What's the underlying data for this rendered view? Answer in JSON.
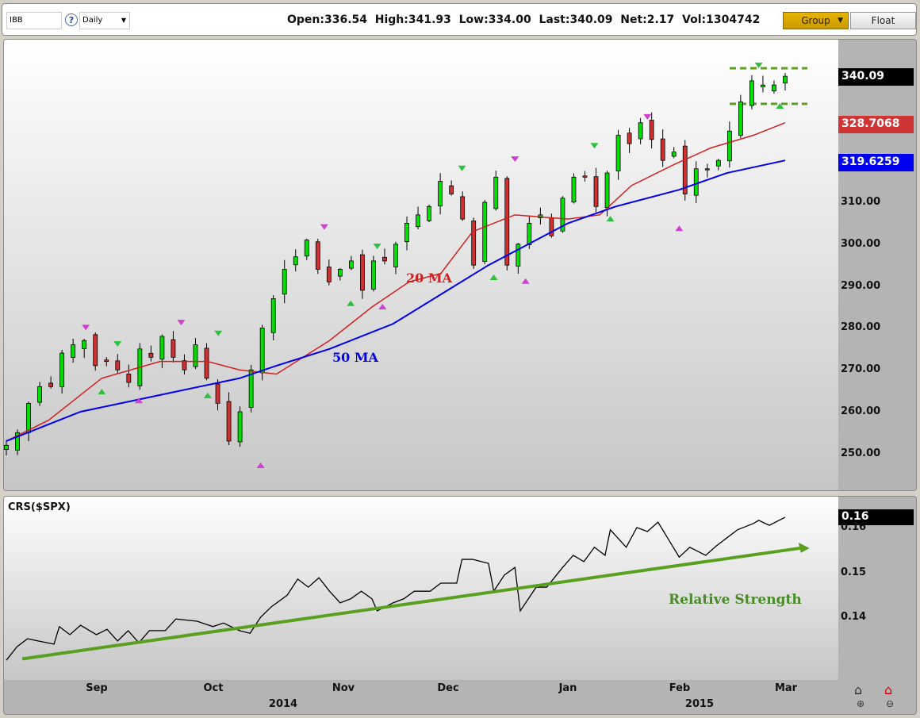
{
  "toolbar": {
    "symbol": "IBB",
    "help": "?",
    "period": "Daily",
    "quote": "Open:336.54  High:341.93  Low:334.00  Last:340.09  Net:2.17  Vol:1304742",
    "group_label": "Group",
    "float_label": "Float"
  },
  "colors": {
    "up": "#00e000",
    "down": "#d03030",
    "ma20": "#d02020",
    "ma50": "#0000ee",
    "rs": "#5aa020",
    "last": "#000000"
  },
  "chart_data": [
    {
      "type": "candlestick",
      "title": "IBB Daily",
      "ylim": [
        244,
        348
      ],
      "price_ticks": [
        "250.00",
        "260.00",
        "270.00",
        "280.00",
        "290.00",
        "300.00",
        "310.00"
      ],
      "last_label": "340.09",
      "ma20_label": "328.7068",
      "ma50_label": "319.6259",
      "closes": [
        252,
        255,
        262,
        266,
        266,
        274,
        276,
        277,
        271,
        272,
        270,
        267,
        275,
        273,
        278,
        273,
        270,
        276,
        268,
        262,
        253,
        260,
        270,
        280,
        287,
        294,
        297,
        301,
        294,
        291,
        294,
        296,
        289,
        296,
        296,
        300,
        305,
        307,
        309,
        315,
        312,
        306,
        295,
        310,
        316,
        295,
        300,
        305,
        307,
        302,
        311,
        316,
        316,
        309,
        317,
        326,
        324,
        329,
        325,
        320,
        322,
        312,
        318,
        318,
        320,
        327,
        334,
        339,
        338,
        338,
        340.09
      ],
      "days_total": 147,
      "ma20": {
        "label": "20 MA",
        "points": [
          [
            0,
            253
          ],
          [
            8,
            258
          ],
          [
            18,
            268
          ],
          [
            29,
            272
          ],
          [
            38,
            272
          ],
          [
            44,
            270
          ],
          [
            51,
            269
          ],
          [
            61,
            277
          ],
          [
            69,
            285
          ],
          [
            76,
            291
          ],
          [
            82,
            293
          ],
          [
            88,
            303
          ],
          [
            96,
            307
          ],
          [
            106,
            306
          ],
          [
            112,
            307
          ],
          [
            118,
            314
          ],
          [
            126,
            319
          ],
          [
            133,
            323
          ],
          [
            141,
            326
          ],
          [
            147,
            329
          ]
        ]
      },
      "ma50": {
        "label": "50 MA",
        "points": [
          [
            0,
            253
          ],
          [
            14,
            260
          ],
          [
            29,
            264
          ],
          [
            44,
            268
          ],
          [
            51,
            271
          ],
          [
            61,
            275
          ],
          [
            73,
            281
          ],
          [
            82,
            288
          ],
          [
            91,
            295
          ],
          [
            97,
            299
          ],
          [
            106,
            305
          ],
          [
            115,
            309
          ],
          [
            127,
            313
          ],
          [
            136,
            317
          ],
          [
            147,
            320
          ]
        ]
      },
      "markers": [
        [
          15,
          280,
          "top"
        ],
        [
          33,
          281.2,
          "top"
        ],
        [
          60,
          304,
          "top"
        ],
        [
          96,
          320.2,
          "top"
        ],
        [
          121,
          330.3,
          "top"
        ],
        [
          25,
          262.8,
          "bottom"
        ],
        [
          48,
          247.3,
          "bottom"
        ],
        [
          71,
          285.2,
          "bottom"
        ],
        [
          98,
          291.3,
          "bottom"
        ],
        [
          127,
          303.9,
          "bottom"
        ],
        [
          21,
          276.1,
          "gdown"
        ],
        [
          40,
          278.6,
          "gdown"
        ],
        [
          70,
          299.4,
          "gdown"
        ],
        [
          86,
          318,
          "gdown"
        ],
        [
          111,
          323.4,
          "gdown"
        ],
        [
          142,
          342.6,
          "gdown"
        ],
        [
          18,
          264.9,
          "gup"
        ],
        [
          38,
          264,
          "gup"
        ],
        [
          65,
          286,
          "gup"
        ],
        [
          92,
          292.2,
          "gup"
        ],
        [
          114,
          306.2,
          "gup"
        ],
        [
          146,
          333.1,
          "gup"
        ]
      ],
      "range_box": [
        333.5,
        342
      ]
    },
    {
      "type": "line",
      "title": "CRS($SPX)",
      "ylim": [
        0.12,
        0.166
      ],
      "ticks": [
        "0.14",
        "0.15",
        "0.16"
      ],
      "last_label": "0.16",
      "annotation": "Relative Strength",
      "x": [
        0,
        2,
        4,
        6,
        9,
        10,
        12,
        14,
        17,
        19,
        21,
        23,
        25,
        27,
        30,
        32,
        36,
        39,
        41,
        44,
        46,
        48,
        50,
        53,
        55,
        57,
        59,
        61,
        63,
        65,
        67,
        69,
        70,
        73,
        75,
        77,
        80,
        82,
        85,
        86,
        88,
        91,
        92,
        94,
        96,
        97,
        100,
        102,
        105,
        107,
        109,
        111,
        113,
        114,
        117,
        119,
        121,
        123,
        125,
        127,
        129,
        132,
        134,
        136,
        138,
        141,
        142,
        144,
        147
      ],
      "y": [
        0.1305,
        0.1335,
        0.1353,
        0.1348,
        0.1341,
        0.138,
        0.1362,
        0.1383,
        0.1362,
        0.1374,
        0.1348,
        0.1371,
        0.1344,
        0.1371,
        0.1371,
        0.1397,
        0.1392,
        0.138,
        0.1388,
        0.1371,
        0.1365,
        0.1401,
        0.1424,
        0.145,
        0.1486,
        0.1468,
        0.1489,
        0.1459,
        0.1433,
        0.1442,
        0.1459,
        0.1442,
        0.1415,
        0.1433,
        0.1442,
        0.1459,
        0.1459,
        0.1477,
        0.1477,
        0.153,
        0.153,
        0.1521,
        0.1459,
        0.1495,
        0.1512,
        0.1415,
        0.1468,
        0.1468,
        0.1512,
        0.1539,
        0.1525,
        0.1557,
        0.1539,
        0.1596,
        0.1557,
        0.1601,
        0.1592,
        0.1613,
        0.1574,
        0.1535,
        0.1557,
        0.1539,
        0.156,
        0.1578,
        0.1596,
        0.161,
        0.1617,
        0.1606,
        0.1624
      ],
      "trend": [
        [
          3,
          0.1308
        ],
        [
          151,
          0.1555
        ]
      ]
    }
  ],
  "xaxis": {
    "months": [
      "Sep",
      "Oct",
      "Nov",
      "Dec",
      "Jan",
      "Feb",
      "Mar"
    ],
    "years": [
      "2014",
      "2015"
    ]
  }
}
